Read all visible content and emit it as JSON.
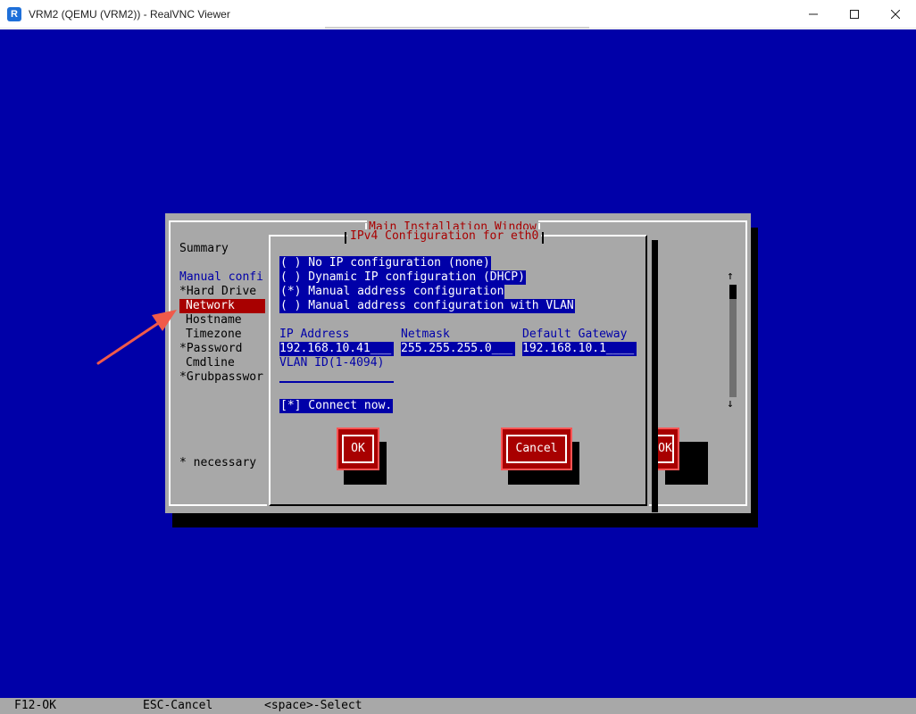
{
  "window": {
    "app_icon": "realvnc-logo",
    "title": "VRM2 (QEMU (VRM2)) - RealVNC Viewer",
    "controls": [
      "minimize-icon",
      "maximize-icon",
      "close-icon"
    ]
  },
  "main_window": {
    "title": "Main Installation Window",
    "summary": "Summary",
    "manual_config": "Manual confi",
    "items": [
      {
        "label": "*Hard Drive",
        "selected": false
      },
      {
        "label": "Network",
        "selected": true
      },
      {
        "label": "Hostname",
        "selected": false
      },
      {
        "label": "Timezone",
        "selected": false
      },
      {
        "label": "*Password",
        "selected": false
      },
      {
        "label": "Cmdline",
        "selected": false
      },
      {
        "label": "*Grubpasswor",
        "selected": false
      }
    ],
    "note": "* necessary",
    "ok_label": "OK"
  },
  "ipv4_dialog": {
    "title": "IPv4 Configuration for eth0",
    "options": [
      {
        "label": "( ) No IP configuration (none)",
        "selected": false
      },
      {
        "label": "( ) Dynamic IP configuration (DHCP)",
        "selected": false
      },
      {
        "label": "(*) Manual address configuration",
        "selected": true
      },
      {
        "label": "( ) Manual address configuration with VLAN",
        "selected": false
      }
    ],
    "fields": {
      "ip_label": "IP Address",
      "ip_value": "192.168.10.41___",
      "netmask_label": "Netmask",
      "netmask_value": "255.255.255.0___",
      "gateway_label": "Default Gateway",
      "gateway_value": "192.168.10.1____",
      "vlan_label": "VLAN ID(1-4094)",
      "vlan_value": ""
    },
    "connect_now": "[*] Connect now.",
    "ok_label": "OK",
    "cancel_label": "Cancel"
  },
  "status_bar": {
    "f12": "F12-OK",
    "esc": "ESC-Cancel",
    "space": "<space>-Select"
  },
  "colors": {
    "tui_blue": "#0000a8",
    "tui_gray": "#a8a8a8",
    "tui_red": "#a80000",
    "annotation_arrow": "#f05a4a"
  }
}
